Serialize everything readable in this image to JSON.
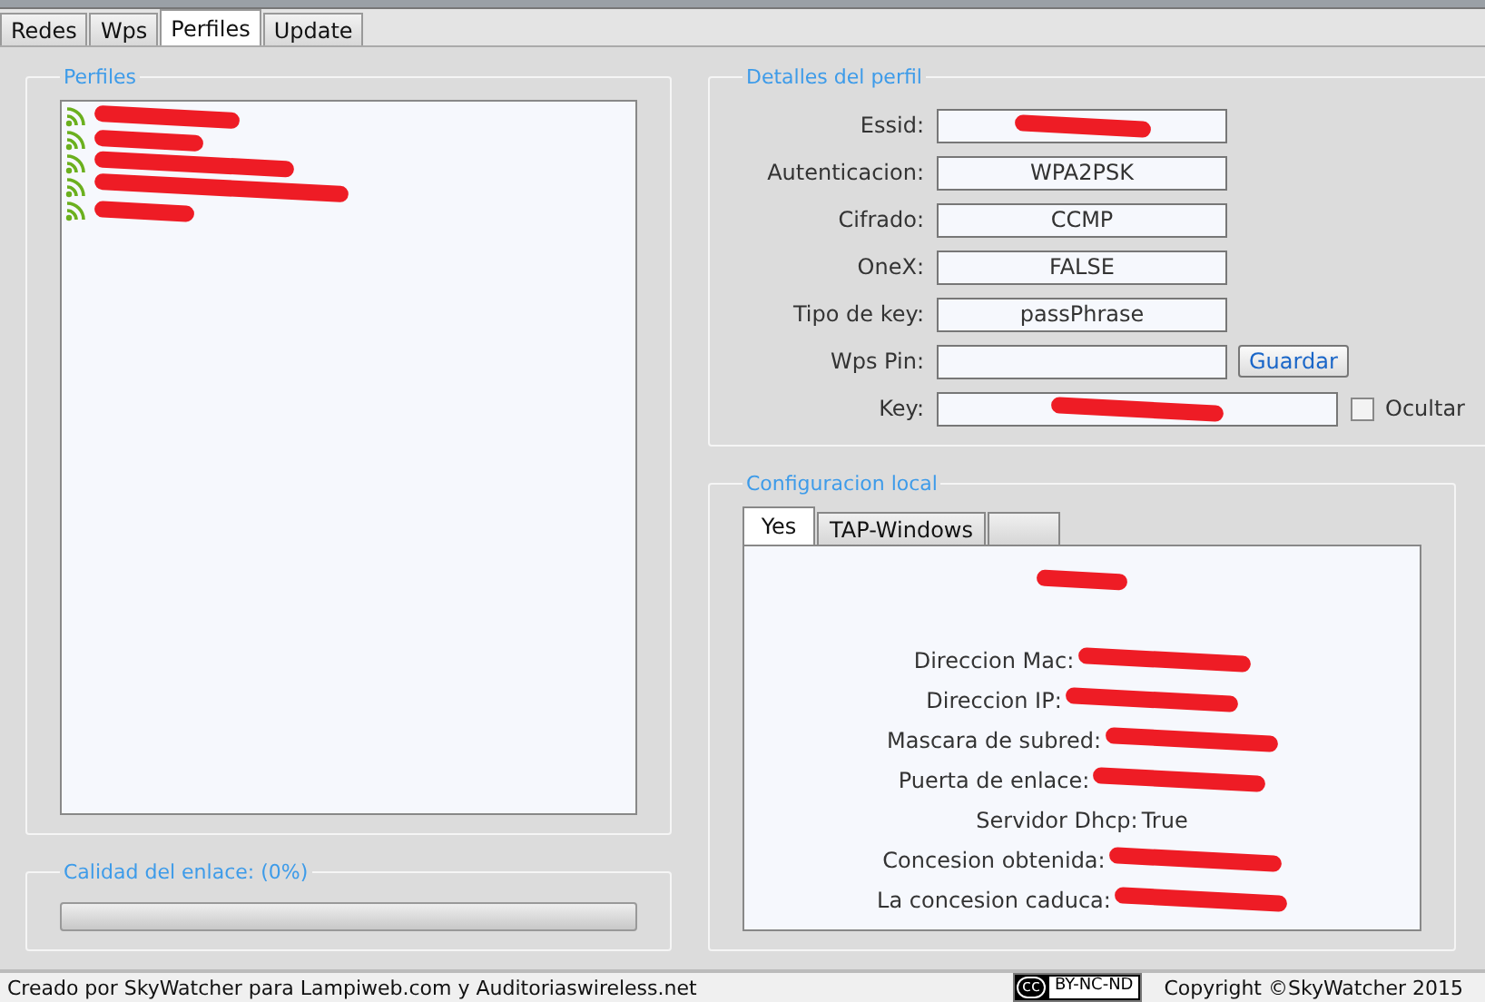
{
  "tabs": [
    {
      "label": "Redes",
      "selected": false
    },
    {
      "label": "Wps",
      "selected": false
    },
    {
      "label": "Perfiles",
      "selected": true
    },
    {
      "label": "Update",
      "selected": false
    }
  ],
  "profiles": {
    "title": "Perfiles",
    "items": [
      {
        "kind": "redacted"
      },
      {
        "kind": "redacted"
      },
      {
        "kind": "redacted"
      },
      {
        "kind": "redacted"
      },
      {
        "kind": "redacted"
      }
    ]
  },
  "link_quality": {
    "title": "Calidad del enlace: (0%)",
    "level": 0
  },
  "details": {
    "title": "Detalles del perfil",
    "rows": [
      {
        "label": "Essid:",
        "kind": "redacted"
      },
      {
        "label": "Autenticacion:",
        "kind": "text",
        "value": "WPA2PSK"
      },
      {
        "label": "Cifrado:",
        "kind": "text",
        "value": "CCMP"
      },
      {
        "label": "OneX:",
        "kind": "text",
        "value": "FALSE"
      },
      {
        "label": "Tipo de key:",
        "kind": "text",
        "value": "passPhrase"
      },
      {
        "label": "Wps Pin:",
        "kind": "input",
        "button": "Guardar"
      },
      {
        "label": "Key:",
        "kind": "key",
        "checkbox": {
          "label": "Ocultar",
          "checked": false
        }
      }
    ]
  },
  "local_config": {
    "title": "Configuracion local",
    "tabs": [
      {
        "label": "Yes",
        "selected": true
      },
      {
        "label": "TAP-Windows",
        "selected": false
      },
      {
        "selected": false
      }
    ],
    "lines": [
      {
        "label": "Direccion Mac:",
        "kind": "redacted"
      },
      {
        "label": "Direccion IP:",
        "kind": "redacted"
      },
      {
        "label": "Mascara de subred:",
        "kind": "redacted"
      },
      {
        "label": "Puerta de enlace:",
        "kind": "redacted"
      },
      {
        "label": "Servidor Dhcp:",
        "kind": "text",
        "value": "True"
      },
      {
        "label": "Concesion obtenida:",
        "kind": "redacted"
      },
      {
        "label": "La concesion caduca:",
        "kind": "redacted"
      }
    ]
  },
  "footer": {
    "credit": "Creado por SkyWatcher para Lampiweb.com y Auditoriaswireless.net",
    "license": {
      "cc": "cc",
      "terms": "BY-NC-ND"
    },
    "copyright": "Copyright ©SkyWatcher 2015"
  }
}
